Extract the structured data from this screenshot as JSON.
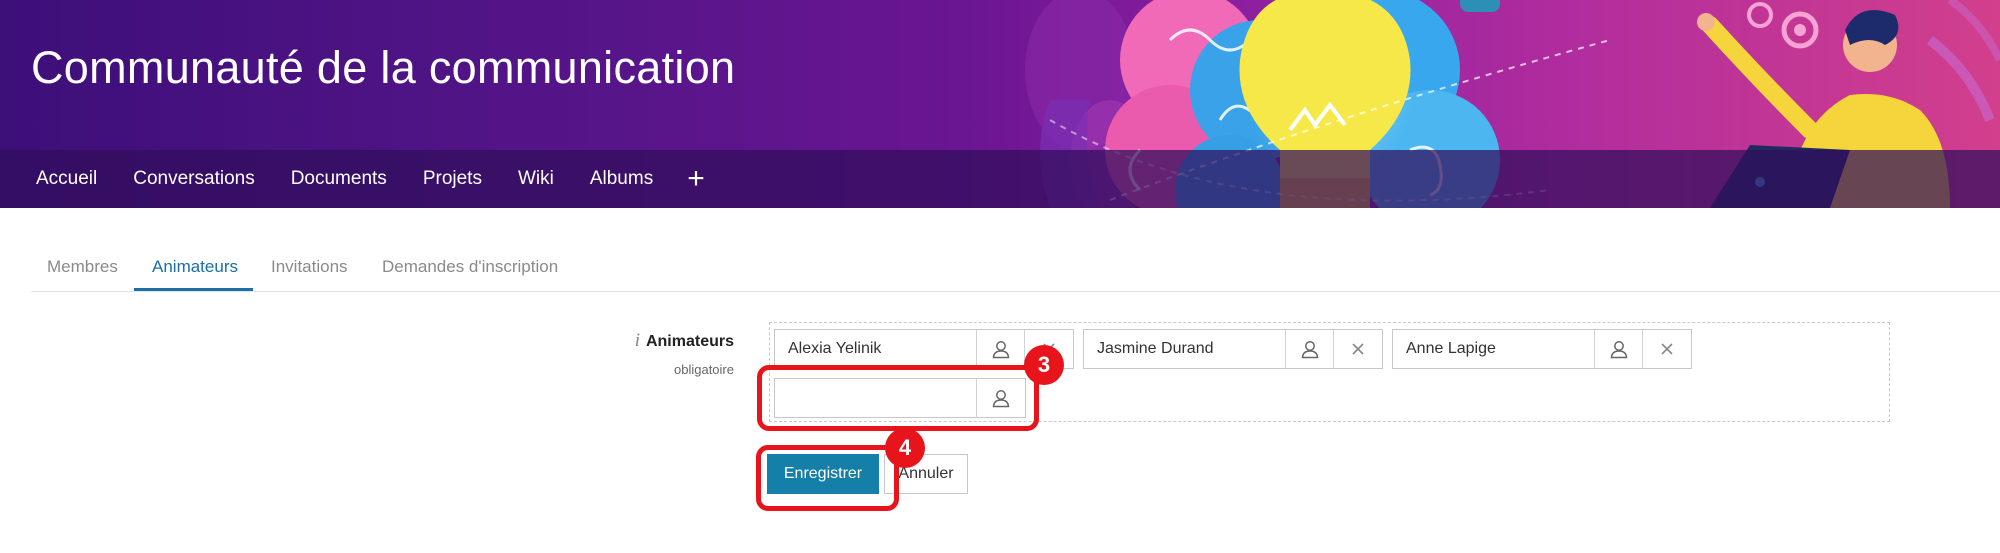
{
  "banner": {
    "title": "Communauté de la communication",
    "nav": [
      "Accueil",
      "Conversations",
      "Documents",
      "Projets",
      "Wiki",
      "Albums"
    ],
    "add_symbol": "+"
  },
  "tabs": [
    {
      "label": "Membres",
      "active": false
    },
    {
      "label": "Animateurs",
      "active": true
    },
    {
      "label": "Invitations",
      "active": false
    },
    {
      "label": "Demandes d'inscription",
      "active": false
    }
  ],
  "form": {
    "info_symbol": "i",
    "field_label": "Animateurs",
    "required_label": "obligatoire",
    "selected_users": [
      "Alexia Yelinik",
      "Jasmine Durand",
      "Anne Lapige"
    ],
    "empty_input_value": "",
    "save_label": "Enregistrer",
    "cancel_label": "Annuler"
  },
  "annotations": {
    "step_input": "3",
    "step_save": "4",
    "highlight_color": "#e8141b"
  },
  "colors": {
    "accent": "#147fa9",
    "active_tab": "#1a6fa6"
  },
  "icons": [
    "person-icon",
    "close-icon",
    "plus-icon",
    "info-icon"
  ]
}
